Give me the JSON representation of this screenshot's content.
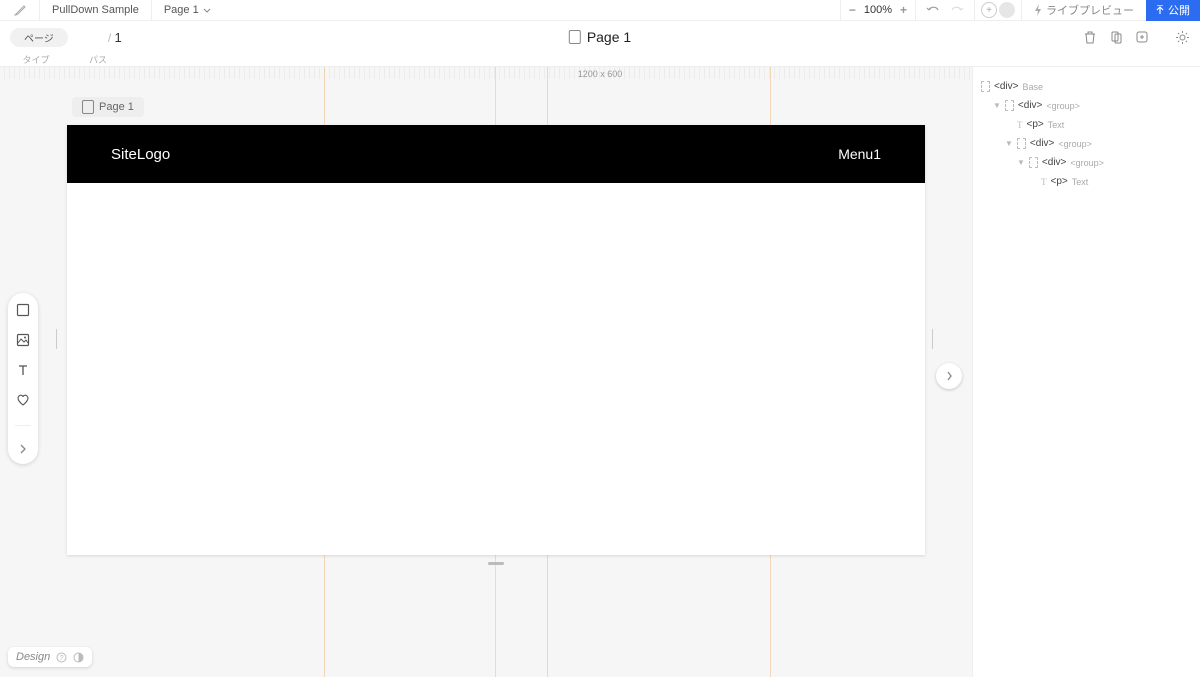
{
  "topbar": {
    "project_name": "PullDown Sample",
    "page_selector": "Page 1",
    "zoom": "100%",
    "preview_label": "ライブプレビュー",
    "publish_label": "公開"
  },
  "secondbar": {
    "pill_label": "ページ",
    "path_num": "1",
    "page_title": "Page 1",
    "meta_type": "タイプ",
    "meta_path": "パス"
  },
  "canvas": {
    "dimensions": "1200 x 600",
    "page_chip": "Page 1",
    "site_logo": "SiteLogo",
    "menu1": "Menu1"
  },
  "tree": {
    "r0_tag": "<div>",
    "r0_lbl": "Base",
    "r1_tag": "<div>",
    "r1_lbl": "<group>",
    "r2_tag": "<p>",
    "r2_lbl": "Text",
    "r3_tag": "<div>",
    "r3_lbl": "<group>",
    "r4_tag": "<div>",
    "r4_lbl": "<group>",
    "r5_tag": "<p>",
    "r5_lbl": "Text"
  },
  "footer": {
    "brand": "Design"
  }
}
